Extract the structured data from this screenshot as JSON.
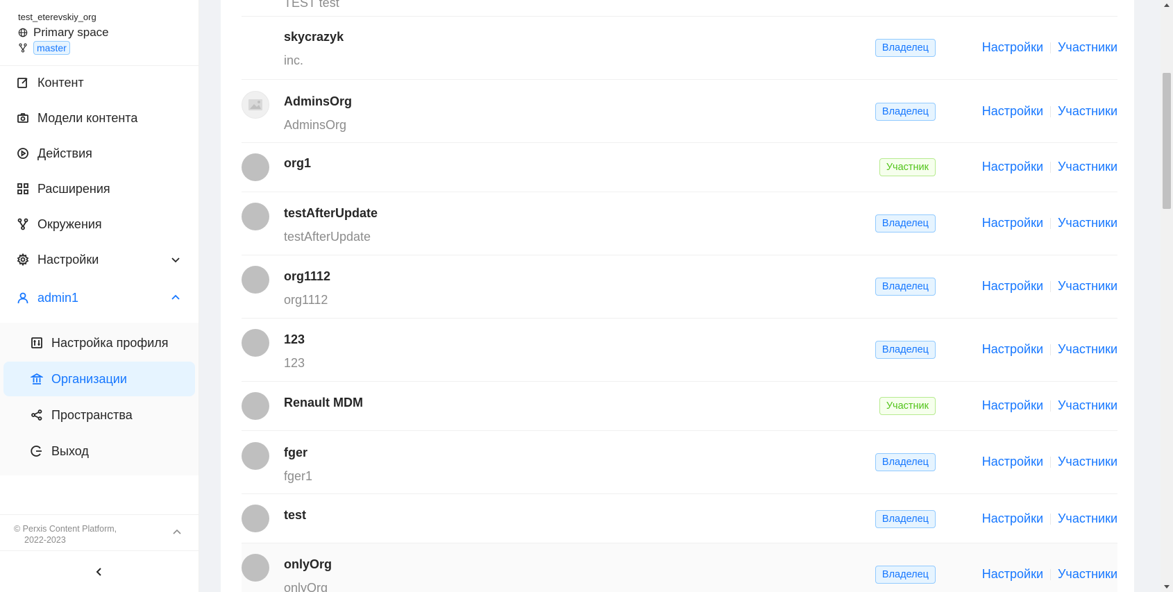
{
  "sidebar": {
    "org_name": "test_eterevskiy_org",
    "space_name": "Primary space",
    "branch": "master",
    "menu": [
      {
        "label": "Контент",
        "icon": "edit-icon"
      },
      {
        "label": "Модели контента",
        "icon": "camera-icon"
      },
      {
        "label": "Действия",
        "icon": "play-circle-icon"
      },
      {
        "label": "Расширения",
        "icon": "apps-icon"
      },
      {
        "label": "Окружения",
        "icon": "branch-icon"
      },
      {
        "label": "Настройки",
        "icon": "gear-icon"
      },
      {
        "label": "admin1",
        "icon": "user-icon"
      }
    ],
    "submenu": [
      {
        "label": "Настройка профиля",
        "icon": "sliders-icon"
      },
      {
        "label": "Организации",
        "icon": "bank-icon",
        "selected": true
      },
      {
        "label": "Пространства",
        "icon": "share-icon"
      },
      {
        "label": "Выход",
        "icon": "logout-icon"
      }
    ],
    "footer_line1": "© Perxis Content Platform,",
    "footer_line2": "2022-2023"
  },
  "orgs": {
    "partial_top_desc": "TEST test",
    "settings_label": "Настройки",
    "members_label": "Участники",
    "rows": [
      {
        "title": "skycrazyk",
        "desc": "inc.",
        "role": "Владелец",
        "avatar": "none"
      },
      {
        "title": "AdminsOrg",
        "desc": "AdminsOrg",
        "role": "Владелец",
        "avatar": "image-placeholder"
      },
      {
        "title": "org1",
        "desc": "",
        "role": "Участник",
        "avatar": "gray"
      },
      {
        "title": "testAfterUpdate",
        "desc": "testAfterUpdate",
        "role": "Владелец",
        "avatar": "gray"
      },
      {
        "title": "org1112",
        "desc": "org1112",
        "role": "Владелец",
        "avatar": "gray"
      },
      {
        "title": "123",
        "desc": "123",
        "role": "Владелец",
        "avatar": "gray"
      },
      {
        "title": "Renault MDM",
        "desc": "",
        "role": "Участник",
        "avatar": "gray"
      },
      {
        "title": "fger",
        "desc": "fger1",
        "role": "Владелец",
        "avatar": "gray"
      },
      {
        "title": "test",
        "desc": "",
        "role": "Владелец",
        "avatar": "gray"
      },
      {
        "title": "onlyOrg",
        "desc": "onlyOrg",
        "role": "Владелец",
        "avatar": "gray"
      }
    ]
  },
  "colors": {
    "accent": "#1677ff",
    "owner_tag_bg": "#e6f4ff",
    "member_tag_text": "#52c41a",
    "avatar_gray": "#bfbfbf"
  }
}
